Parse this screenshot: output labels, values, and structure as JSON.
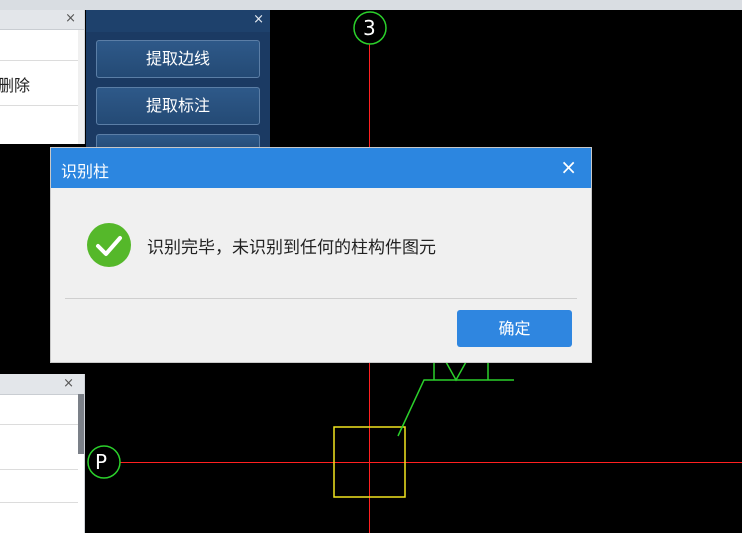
{
  "left_panel_top": {
    "close_label": "×",
    "delete_label": "删除"
  },
  "left_panel_bottom": {
    "close_label": "×"
  },
  "tool_panel": {
    "close_label": "×",
    "buttons": [
      {
        "label": "提取边线"
      },
      {
        "label": "提取标注"
      }
    ]
  },
  "canvas": {
    "axis_labels": {
      "top": "3",
      "left": "P"
    },
    "colors": {
      "axis": "#ff2020",
      "bubble": "#2bd02b",
      "column": "#f2e51f",
      "leader": "#2bd02b"
    }
  },
  "dialog": {
    "title": "识别柱",
    "close_label": "×",
    "message": "识别完毕，未识别到任何的柱构件图元",
    "ok_label": "确定",
    "icon": "check-icon"
  }
}
